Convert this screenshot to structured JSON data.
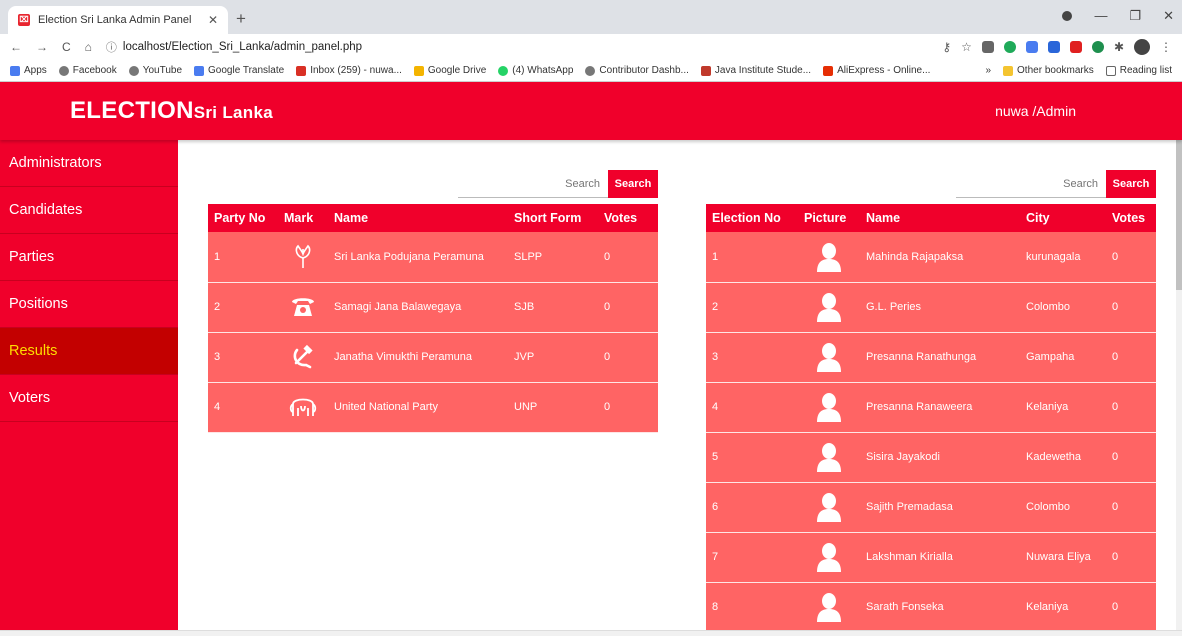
{
  "browser": {
    "tab_title": "Election Sri Lanka Admin Panel",
    "url": "localhost/Election_Sri_Lanka/admin_panel.php",
    "bookmarks": [
      {
        "label": "Apps"
      },
      {
        "label": "Facebook"
      },
      {
        "label": "YouTube"
      },
      {
        "label": "Google Translate"
      },
      {
        "label": "Inbox (259) - nuwa..."
      },
      {
        "label": "Google Drive"
      },
      {
        "label": "(4) WhatsApp"
      },
      {
        "label": "Contributor Dashb..."
      },
      {
        "label": "Java Institute Stude..."
      },
      {
        "label": "AliExpress - Online..."
      }
    ],
    "other_bookmarks": "Other bookmarks",
    "reading_list": "Reading list"
  },
  "header": {
    "brand_main": "ELECTION",
    "brand_sub": "Sri Lanka",
    "user": "nuwa /Admin"
  },
  "sidebar": {
    "items": [
      {
        "label": "Administrators"
      },
      {
        "label": "Candidates"
      },
      {
        "label": "Parties"
      },
      {
        "label": "Positions"
      },
      {
        "label": "Results",
        "active": true
      },
      {
        "label": "Voters"
      }
    ]
  },
  "parties": {
    "search_placeholder": "Search",
    "search_button": "Search",
    "columns": [
      "Party No",
      "Mark",
      "Name",
      "Short Form",
      "Votes"
    ],
    "rows": [
      {
        "no": "1",
        "mark": "flower-icon",
        "name": "Sri Lanka Podujana Peramuna",
        "short": "SLPP",
        "votes": "0"
      },
      {
        "no": "2",
        "mark": "telephone-icon",
        "name": "Samagi Jana Balawegaya",
        "short": "SJB",
        "votes": "0"
      },
      {
        "no": "3",
        "mark": "hammer-sickle-icon",
        "name": "Janatha Vimukthi Peramuna",
        "short": "JVP",
        "votes": "0"
      },
      {
        "no": "4",
        "mark": "elephant-icon",
        "name": "United National Party",
        "short": "UNP",
        "votes": "0"
      }
    ]
  },
  "candidates": {
    "search_placeholder": "Search",
    "search_button": "Search",
    "columns": [
      "Election No",
      "Picture",
      "Name",
      "City",
      "Votes"
    ],
    "rows": [
      {
        "no": "1",
        "name": "Mahinda Rajapaksa",
        "city": "kurunagala",
        "votes": "0"
      },
      {
        "no": "2",
        "name": "G.L. Peries",
        "city": "Colombo",
        "votes": "0"
      },
      {
        "no": "3",
        "name": "Presanna Ranathunga",
        "city": "Gampaha",
        "votes": "0"
      },
      {
        "no": "4",
        "name": "Presanna Ranaweera",
        "city": "Kelaniya",
        "votes": "0"
      },
      {
        "no": "5",
        "name": "Sisira Jayakodi",
        "city": "Kadewetha",
        "votes": "0"
      },
      {
        "no": "6",
        "name": "Sajith Premadasa",
        "city": "Colombo",
        "votes": "0"
      },
      {
        "no": "7",
        "name": "Lakshman Kirialla",
        "city": "Nuwara Eliya",
        "votes": "0"
      },
      {
        "no": "8",
        "name": "Sarath Fonseka",
        "city": "Kelaniya",
        "votes": "0"
      }
    ]
  },
  "colors": {
    "primary": "#f0002b",
    "row": "#ff6464",
    "active": "#c30000",
    "active_text": "#ffdd00"
  }
}
